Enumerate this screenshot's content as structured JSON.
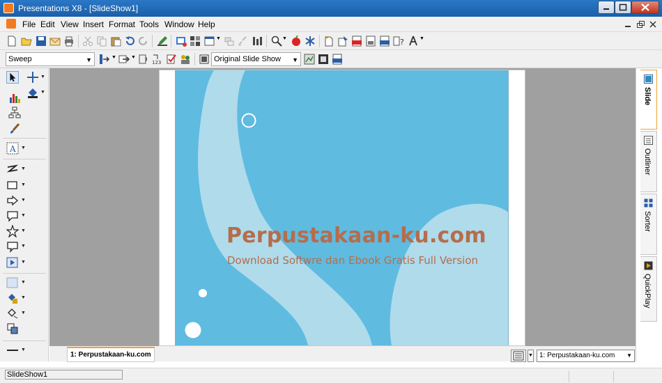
{
  "window": {
    "title": "Presentations X8 - [SlideShow1]",
    "minimize": "0",
    "maximize": "1",
    "close": "r"
  },
  "menu": {
    "items": [
      "File",
      "Edit",
      "View",
      "Insert",
      "Format",
      "Tools",
      "Window",
      "Help"
    ]
  },
  "toolbar2": {
    "transition_value": "Sweep",
    "slideshow_value": "Original Slide Show"
  },
  "slide": {
    "title": "Perpustakaan-ku.com",
    "subtitle": "Download Softwre dan Ebook Gratis Full Version"
  },
  "side_tabs": [
    "Slide",
    "Outliner",
    "Sorter",
    "QuickPlay"
  ],
  "bottom": {
    "slide_tab": "1: Perpustakaan-ku.com",
    "nav_select": "1: Perpustakaan-ku.com"
  },
  "status": {
    "document": "SlideShow1"
  },
  "colors": {
    "titlebar": "#1f67b4",
    "slide_background": "#5fbbe0",
    "slide_shape": "#afdbeb",
    "slide_text": "#b56d4c",
    "active_tab_accent": "#f0a030"
  }
}
